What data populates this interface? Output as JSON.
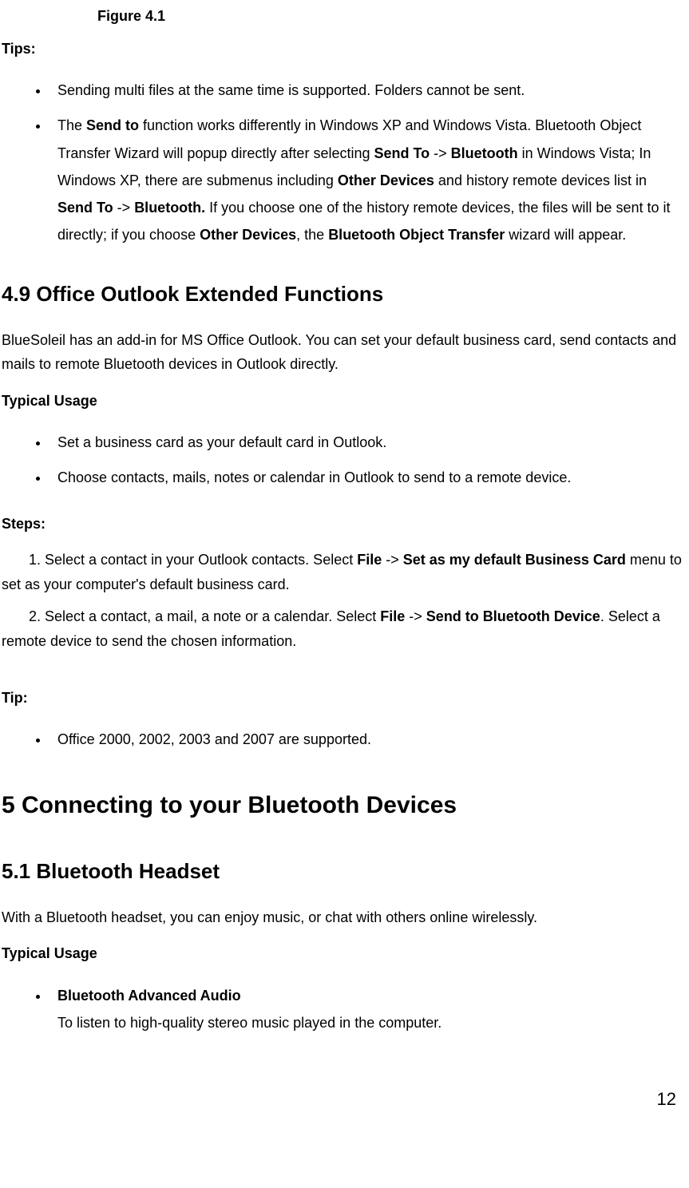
{
  "figure_label": "Figure 4.1",
  "tips_label": "Tips:",
  "tips_list": {
    "item1": "Sending multi files at the same time is supported. Folders cannot be sent.",
    "item2": {
      "seg1": "The ",
      "seg2": "Send to",
      "seg3": " function works differently in Windows XP and Windows Vista. Bluetooth Object Transfer Wizard will popup directly after selecting ",
      "seg4": "Send To",
      "seg5": " -> ",
      "seg6": "Bluetooth",
      "seg7": " in Windows Vista; In Windows XP, there are submenus including ",
      "seg8": "Other Devices",
      "seg9": " and history remote devices list in ",
      "seg10": "Send To",
      "seg11": " -> ",
      "seg12": "Bluetooth.",
      "seg13": " If you choose one of the history remote devices, the files will be sent to it directly; if you choose ",
      "seg14": "Other Devices",
      "seg15": ", the ",
      "seg16": "Bluetooth Object Transfer",
      "seg17": " wizard will appear."
    }
  },
  "section_4_9": {
    "heading": "4.9   Office Outlook Extended Functions",
    "intro": "BlueSoleil has an add-in for MS Office Outlook. You can set your default business card, send contacts and mails to remote Bluetooth devices in Outlook directly.",
    "typical_usage_label": "Typical Usage",
    "usage_list": {
      "item1": "Set a business card as your default card in Outlook.",
      "item2": "Choose contacts, mails, notes or calendar in Outlook to send to a remote device."
    },
    "steps_label": "Steps:",
    "step1": {
      "seg1": "1. Select a contact in your Outlook contacts. Select ",
      "seg2": "File",
      "seg3": " -> ",
      "seg4": "Set as my default Business Card",
      "seg5": " menu to set as your computer's default business card."
    },
    "step2": {
      "seg1": "2. Select a contact, a mail, a note or a calendar. Select ",
      "seg2": "File",
      "seg3": " -> ",
      "seg4": "Send to Bluetooth Device",
      "seg5": ". Select a remote device to send the chosen information."
    },
    "tip_label": "Tip:",
    "tip_item": "Office 2000, 2002, 2003 and 2007 are supported."
  },
  "chapter_5": {
    "heading": "5    Connecting to your Bluetooth Devices"
  },
  "section_5_1": {
    "heading": "5.1   Bluetooth Headset",
    "intro": "With a Bluetooth headset, you can enjoy music, or chat with others online wirelessly.",
    "typical_usage_label": "Typical Usage",
    "usage_item": {
      "title": "Bluetooth Advanced Audio",
      "desc": "To listen to high-quality stereo music played in the computer."
    }
  },
  "page_number": "12"
}
